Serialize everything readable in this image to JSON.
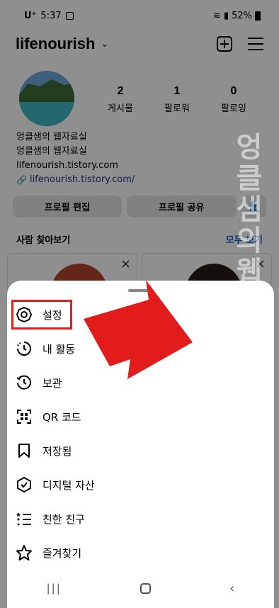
{
  "status_bar": {
    "carrier": "U⁺",
    "time": "5:37",
    "battery": "52%"
  },
  "header": {
    "username": "lifenourish",
    "chevron": "⌄"
  },
  "stats": [
    {
      "num": "2",
      "label": "게시물"
    },
    {
      "num": "1",
      "label": "팔로워"
    },
    {
      "num": "0",
      "label": "팔로잉"
    }
  ],
  "bio": {
    "line1": "엉클샘의 웹자료실",
    "line2": "엉클샘의 웹자료실",
    "line3": "lifenourish.tistory.com",
    "link": "lifenourish.tistory.com/"
  },
  "buttons": {
    "edit": "프로필 편집",
    "share": "프로필 공유"
  },
  "discover": {
    "title": "사람 찾아보기",
    "see_all": "모두 보기"
  },
  "watermark": "엉클샘의웹자료실",
  "menu": [
    {
      "label": "설정",
      "icon": "gear-icon"
    },
    {
      "label": "내 활동",
      "icon": "activity-icon"
    },
    {
      "label": "보관",
      "icon": "archive-icon"
    },
    {
      "label": "QR 코드",
      "icon": "qr-code-icon"
    },
    {
      "label": "저장됨",
      "icon": "bookmark-icon"
    },
    {
      "label": "디지털 자산",
      "icon": "verified-shield-icon"
    },
    {
      "label": "친한 친구",
      "icon": "close-friends-icon"
    },
    {
      "label": "즐겨찾기",
      "icon": "star-icon"
    }
  ],
  "colors": {
    "highlight": "#e02020",
    "link": "#1c3b7a",
    "accent": "#1c60c8"
  }
}
